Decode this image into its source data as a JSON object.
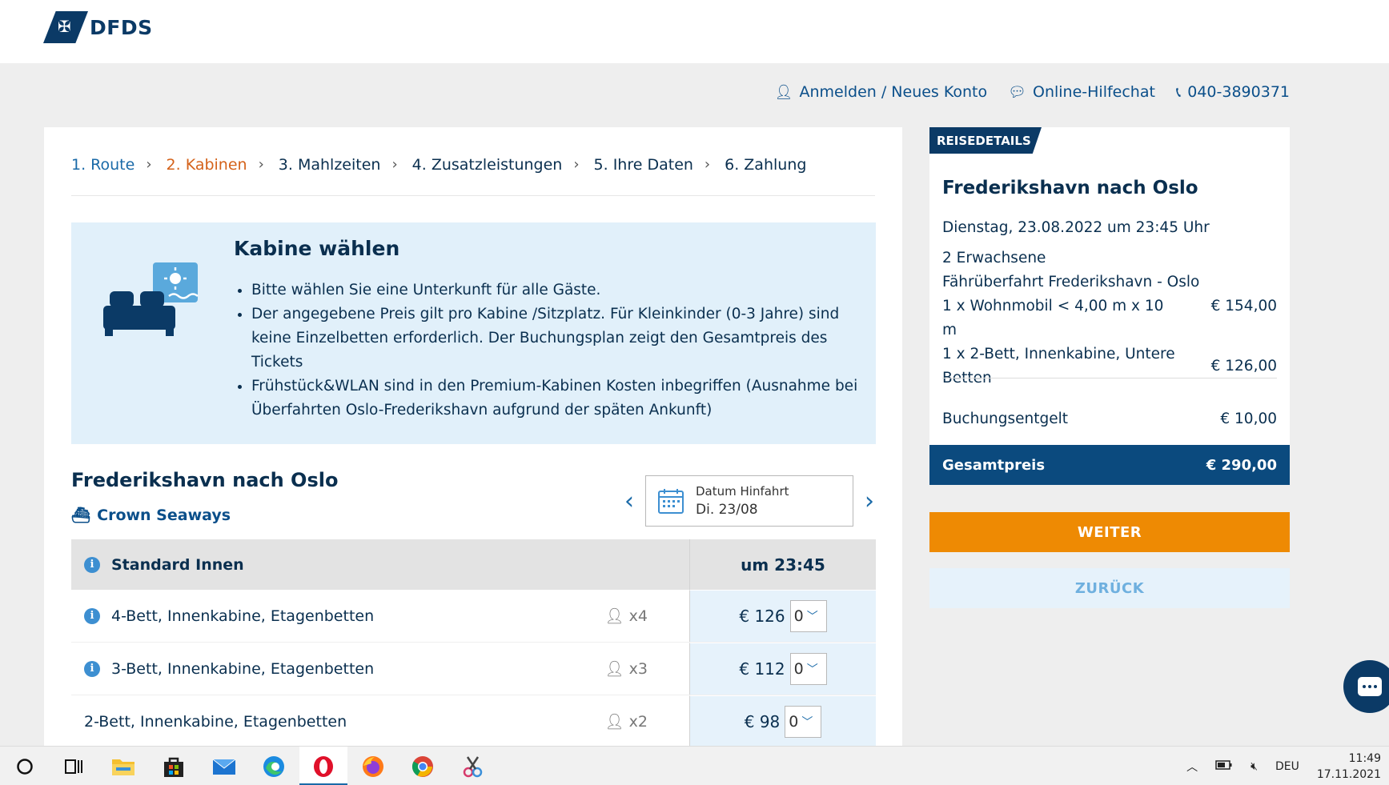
{
  "brand": {
    "logo_text": "DFDS"
  },
  "utility_links": {
    "login": "Anmelden / Neues Konto",
    "chat": "Online-Hilfechat",
    "phone": "040-3890371"
  },
  "steps": [
    {
      "label": "1. Route",
      "state": "done"
    },
    {
      "label": "2. Kabinen",
      "state": "active"
    },
    {
      "label": "3. Mahlzeiten",
      "state": "todo"
    },
    {
      "label": "4. Zusatzleistungen",
      "state": "todo"
    },
    {
      "label": "5. Ihre Daten",
      "state": "todo"
    },
    {
      "label": "6. Zahlung",
      "state": "todo"
    }
  ],
  "info": {
    "title": "Kabine wählen",
    "bullets": [
      "Bitte wählen Sie eine Unterkunft für alle Gäste.",
      "Der angegebene Preis gilt pro Kabine /Sitzplatz. Für Kleinkinder (0-3 Jahre) sind keine Einzelbetten erforderlich. Der Buchungsplan zeigt den Gesamtpreis des Tickets",
      "Frühstück&WLAN sind in den Premium-Kabinen Kosten inbegriffen (Ausnahme bei Überfahrten Oslo-Frederikshavn aufgrund der späten Ankunft)"
    ]
  },
  "route": {
    "title": "Frederikshavn nach Oslo",
    "ship": "Crown Seaways",
    "date_label": "Datum Hinfahrt",
    "date_value": "Di. 23/08"
  },
  "table": {
    "category": "Standard Innen",
    "time": "um 23:45",
    "rows": [
      {
        "name": "4-Bett, Innenkabine, Etagenbetten",
        "pax": "x4",
        "price": "€ 126",
        "qty": "0",
        "info": true
      },
      {
        "name": "3-Bett, Innenkabine, Etagenbetten",
        "pax": "x3",
        "price": "€ 112",
        "qty": "0",
        "info": true
      },
      {
        "name": "2-Bett, Innenkabine, Etagenbetten",
        "pax": "x2",
        "price": "€ 98",
        "qty": "0",
        "info": false
      }
    ]
  },
  "sidebar": {
    "tag": "REISEDETAILS",
    "title": "Frederikshavn nach Oslo",
    "date": "Dienstag, 23.08.2022 um 23:45 Uhr",
    "passengers": "2 Erwachsene",
    "crossing": "Fährüberfahrt Frederikshavn - Oslo",
    "item1_label": "1 x Wohnmobil < 4,00 m x 10 m",
    "item1_price": "€ 154,00",
    "item2_label": "1 x 2-Bett, Innenkabine, Untere Betten",
    "item2_price": "€ 126,00",
    "fee_label": "Buchungsentgelt",
    "fee_price": "€ 10,00",
    "total_label": "Gesamtpreis",
    "total_price": "€ 290,00"
  },
  "buttons": {
    "next": "WEITER",
    "back": "ZURÜCK"
  },
  "taskbar": {
    "lang": "DEU",
    "time": "11:49",
    "date": "17.11.2021"
  },
  "colors": {
    "brand": "#0b3a66",
    "accent": "#ee8a03",
    "active_step": "#d4621a",
    "link": "#1a6aa8"
  }
}
